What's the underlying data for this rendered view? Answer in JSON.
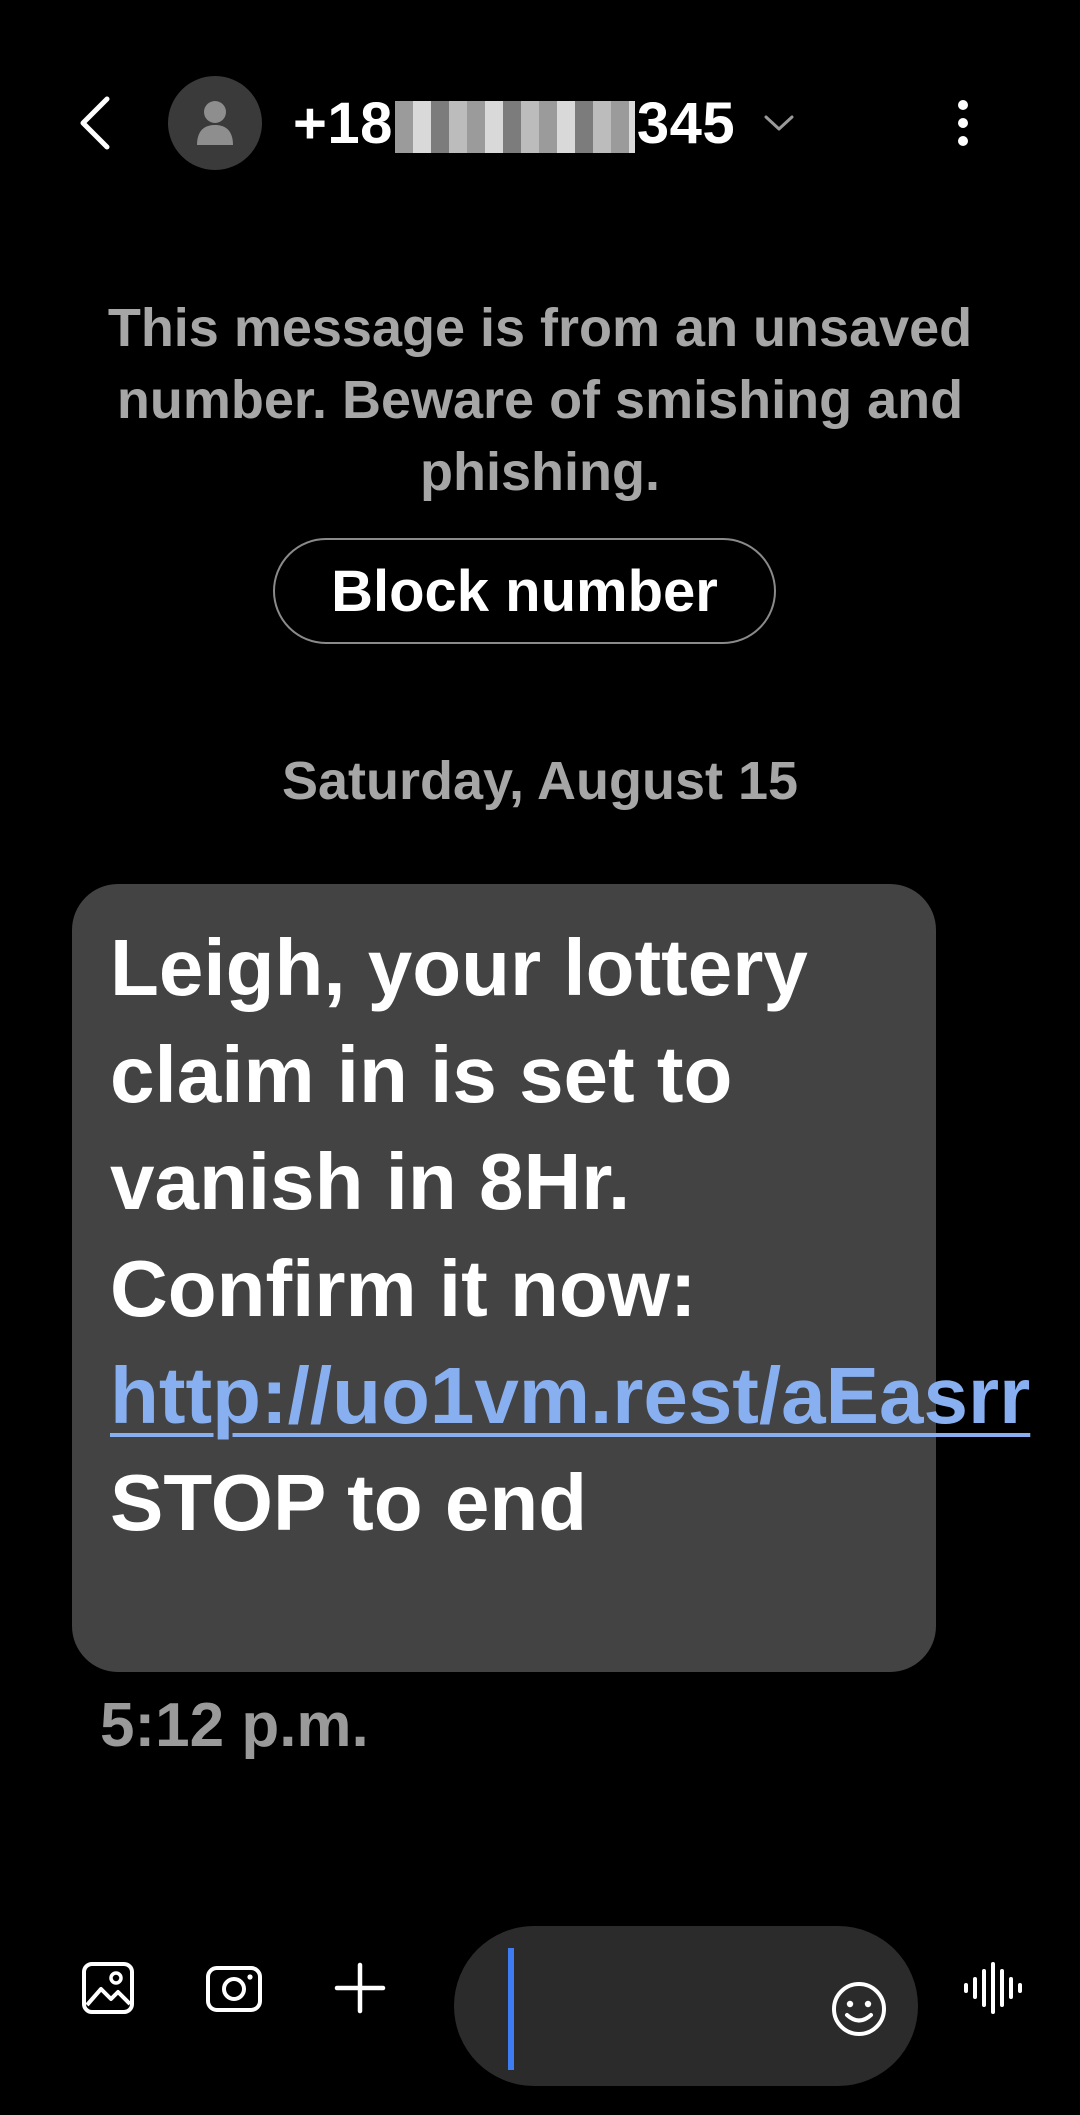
{
  "header": {
    "contact_prefix": "+18",
    "contact_suffix": "345"
  },
  "warning": {
    "text": "This message is from an unsaved number. Beware of smishing and phishing.",
    "block_label": "Block number"
  },
  "date_separator": "Saturday, August 15",
  "message": {
    "text_part1": "Leigh, your lottery claim in is set to vanish in 8Hr. Confirm it now: ",
    "link": "http://uo1vm.rest/aEasrr",
    "text_part2": " STOP to end",
    "timestamp": "5:12 p.m."
  },
  "composer": {
    "placeholder": ""
  },
  "icons": {
    "back": "back-arrow-icon",
    "avatar": "person-icon",
    "chevron": "chevron-down-icon",
    "more": "more-vertical-icon",
    "gallery": "gallery-icon",
    "camera": "camera-icon",
    "add": "plus-icon",
    "emoji": "emoji-icon",
    "voice": "voice-waveform-icon"
  },
  "colors": {
    "background": "#000000",
    "bubble": "#434343",
    "link": "#88aff0",
    "caret": "#3d7cf2",
    "muted_text": "#a6a6a6"
  }
}
